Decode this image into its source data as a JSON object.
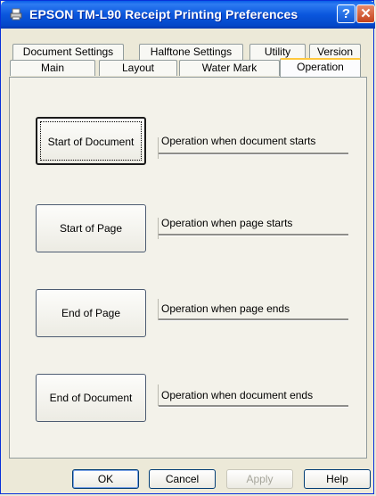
{
  "window": {
    "title": "EPSON TM-L90 Receipt Printing Preferences",
    "help_glyph": "?",
    "close_glyph": "✕"
  },
  "tabs_row1": [
    "Document Settings",
    "Halftone Settings",
    "Utility",
    "Version"
  ],
  "tabs_row2": [
    "Main",
    "Layout",
    "Water Mark",
    "Operation"
  ],
  "selected_tab": "Operation",
  "operations": [
    {
      "button": "Start of Document",
      "description": "Operation when document starts"
    },
    {
      "button": "Start of Page",
      "description": "Operation when page starts"
    },
    {
      "button": "End of Page",
      "description": "Operation when page ends"
    },
    {
      "button": "End of Document",
      "description": "Operation when document ends"
    }
  ],
  "buttons": {
    "ok": "OK",
    "cancel": "Cancel",
    "apply": "Apply",
    "help": "Help"
  },
  "colors": {
    "titlebar": "#0a56dd",
    "selected_tab_accent": "#ffc83c",
    "close_button": "#c4421c"
  }
}
